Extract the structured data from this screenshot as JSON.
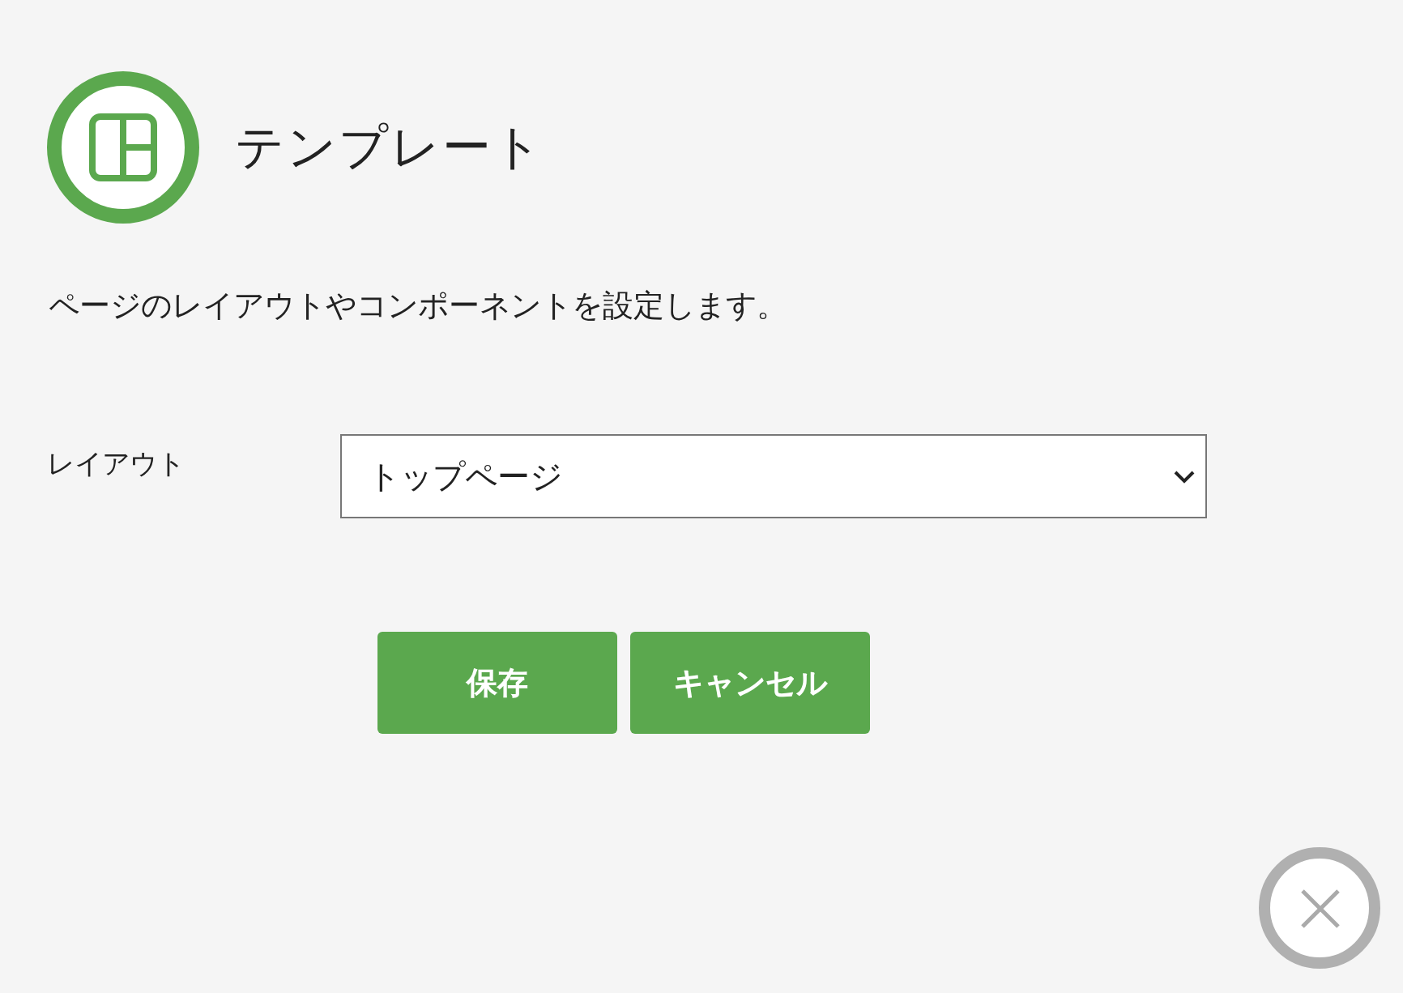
{
  "header": {
    "title": "テンプレート"
  },
  "description": "ページのレイアウトやコンポーネントを設定します。",
  "fields": [
    {
      "label": "レイアウト",
      "value": "トップページ"
    }
  ],
  "buttons": [
    {
      "label": "保存"
    },
    {
      "label": "キャンセル"
    }
  ]
}
